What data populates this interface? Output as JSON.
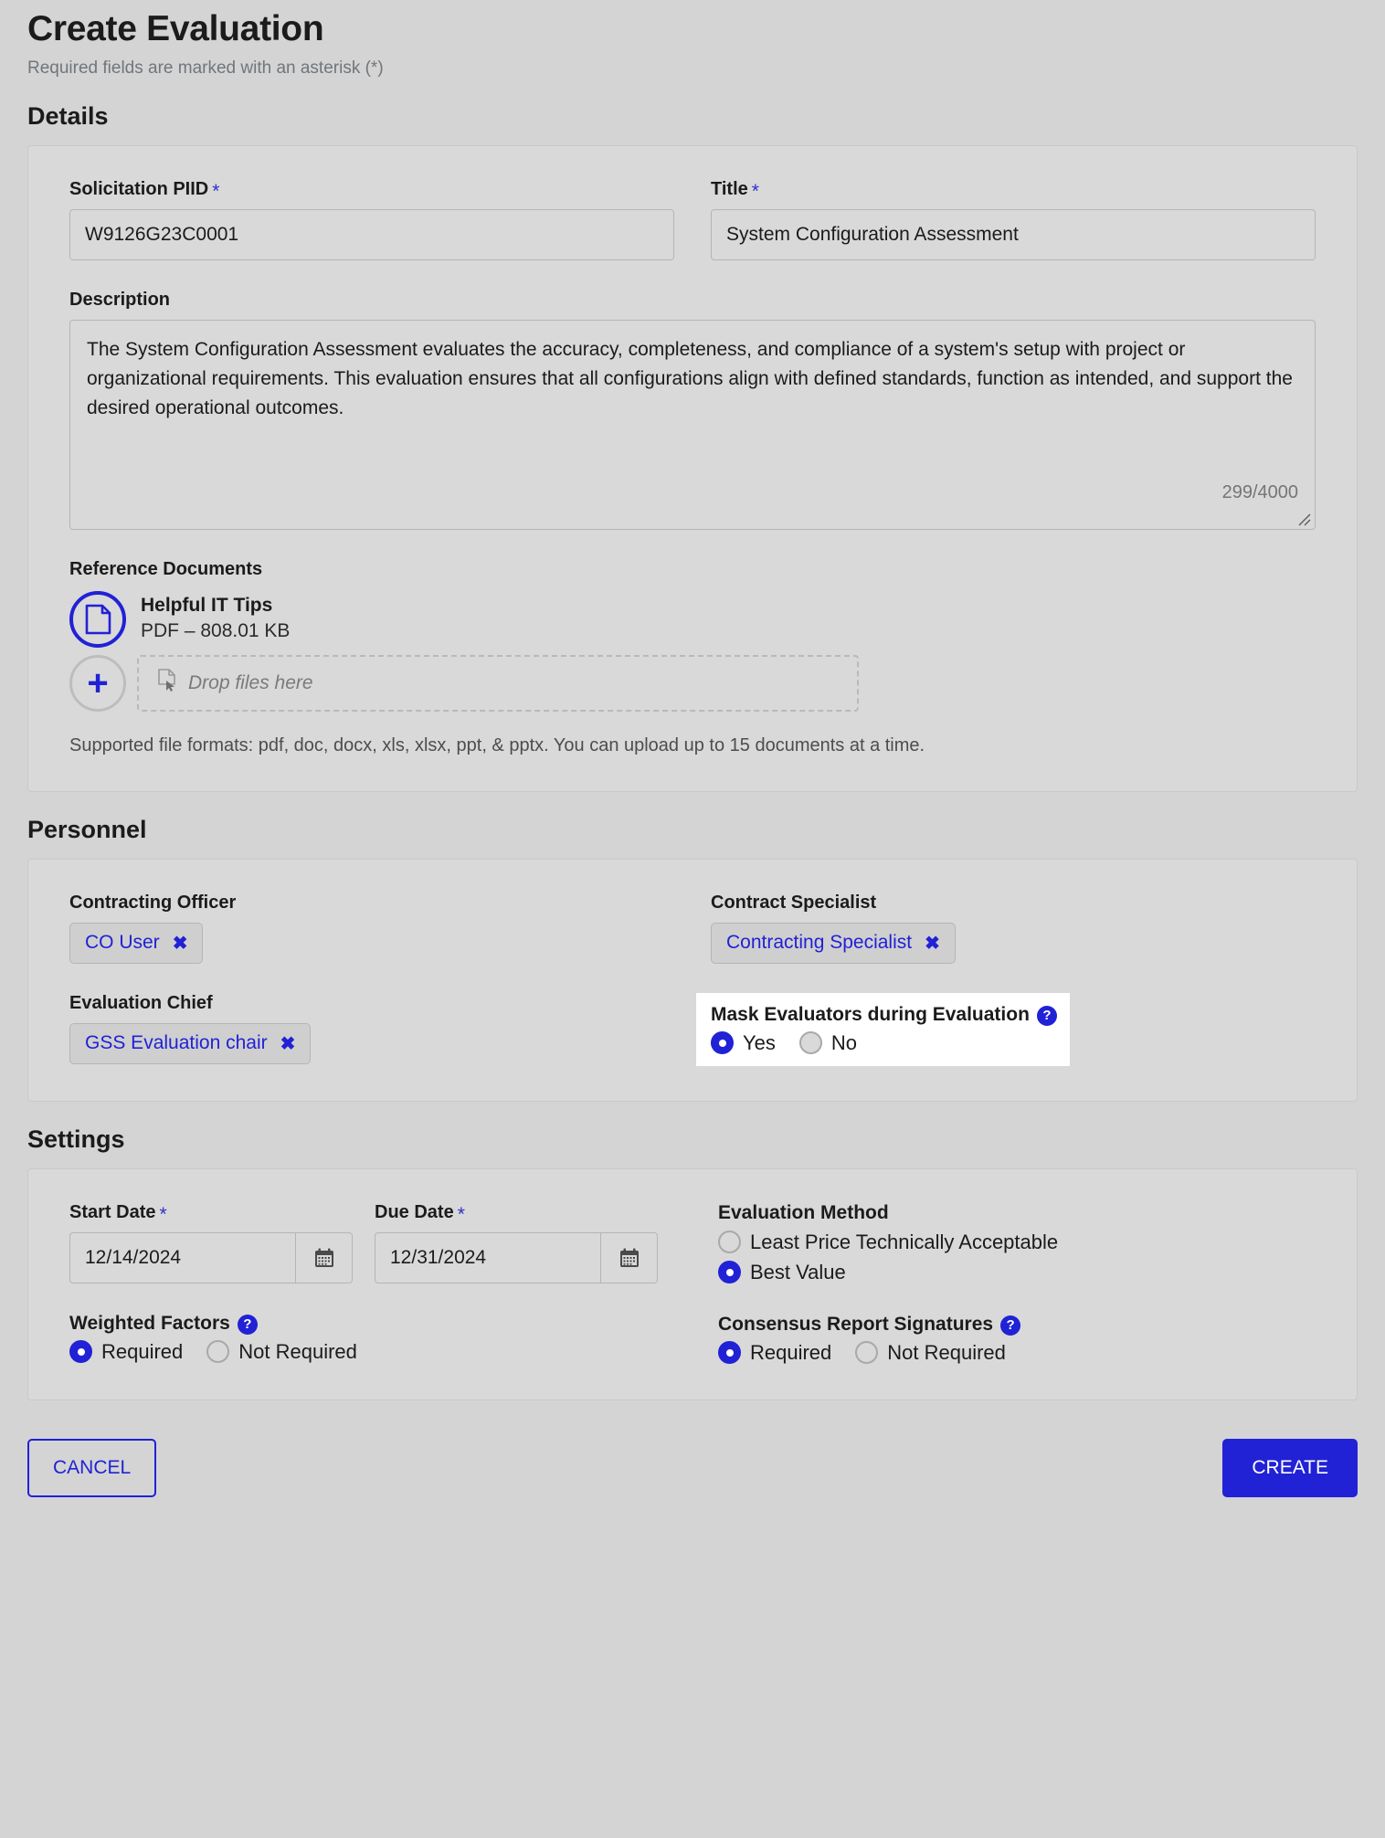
{
  "header": {
    "title": "Create Evaluation",
    "subtitle": "Required fields are marked with an asterisk (*)"
  },
  "sections": {
    "details": "Details",
    "personnel": "Personnel",
    "settings": "Settings"
  },
  "details": {
    "solicitation_piid": {
      "label": "Solicitation PIID",
      "required_marker": "*",
      "value": "W9126G23C0001"
    },
    "title": {
      "label": "Title",
      "required_marker": "*",
      "value": "System Configuration Assessment"
    },
    "description": {
      "label": "Description",
      "value": "The System Configuration Assessment evaluates the accuracy, completeness, and compliance of a system's setup with project or organizational requirements. This evaluation ensures that all configurations align with defined standards, function as intended, and support the desired operational outcomes.",
      "counter": "299/4000"
    },
    "reference_documents": {
      "label": "Reference Documents",
      "files": [
        {
          "name": "Helpful IT Tips",
          "meta": "PDF – 808.01 KB",
          "icon": "pdf-document-icon"
        }
      ],
      "dropzone_text": "Drop files here",
      "add_button_symbol": "+",
      "formats_note": "Supported file formats: pdf, doc, docx, xls, xlsx, ppt, & pptx. You can upload up to 15 documents at a time."
    }
  },
  "personnel": {
    "contracting_officer": {
      "label": "Contracting Officer",
      "chip": "CO User",
      "remove_symbol": "✖"
    },
    "contract_specialist": {
      "label": "Contract Specialist",
      "chip": "Contracting Specialist",
      "remove_symbol": "✖"
    },
    "evaluation_chief": {
      "label": "Evaluation Chief",
      "chip": "GSS Evaluation chair",
      "remove_symbol": "✖"
    },
    "mask_evaluators": {
      "label": "Mask Evaluators during Evaluation",
      "help_symbol": "?",
      "options": [
        {
          "label": "Yes",
          "selected": true
        },
        {
          "label": "No",
          "selected": false
        }
      ]
    }
  },
  "settings": {
    "start_date": {
      "label": "Start Date",
      "required_marker": "*",
      "value": "12/14/2024",
      "calendar_icon": "calendar-icon"
    },
    "due_date": {
      "label": "Due Date",
      "required_marker": "*",
      "value": "12/31/2024",
      "calendar_icon": "calendar-icon"
    },
    "evaluation_method": {
      "label": "Evaluation Method",
      "options": [
        {
          "label": "Least Price Technically Acceptable",
          "selected": false
        },
        {
          "label": "Best Value",
          "selected": true
        }
      ]
    },
    "weighted_factors": {
      "label": "Weighted Factors",
      "help_symbol": "?",
      "options": [
        {
          "label": "Required",
          "selected": true
        },
        {
          "label": "Not Required",
          "selected": false
        }
      ]
    },
    "consensus_report_signatures": {
      "label": "Consensus Report Signatures",
      "help_symbol": "?",
      "options": [
        {
          "label": "Required",
          "selected": true
        },
        {
          "label": "Not Required",
          "selected": false
        }
      ]
    }
  },
  "footer": {
    "cancel_label": "CANCEL",
    "create_label": "CREATE"
  },
  "colors": {
    "accent": "#2121d6",
    "page_bg": "#d4d4d4",
    "card_bg": "#d9d9d9",
    "muted_text": "#71767a",
    "highlight_bg": "#ffffff"
  }
}
